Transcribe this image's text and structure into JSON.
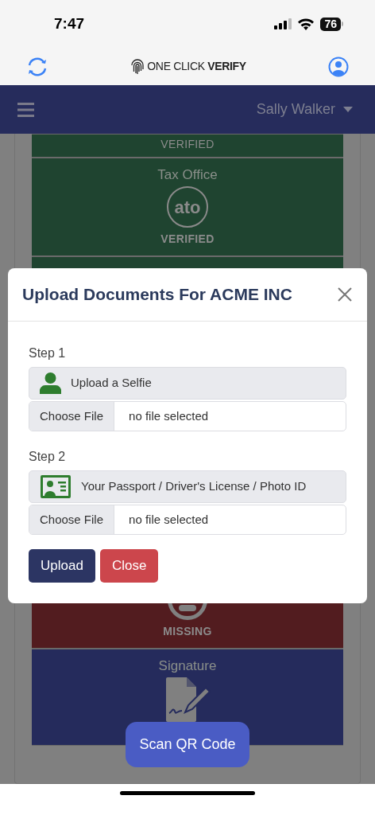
{
  "status_bar": {
    "time": "7:47",
    "battery": "76"
  },
  "app_header": {
    "logo_light": "ONE CLICK",
    "logo_bold": "VERIFY"
  },
  "navbar": {
    "user": "Sally Walker"
  },
  "cards": [
    {
      "kind": "verified",
      "status_label": "VERIFIED",
      "emphasis": false
    },
    {
      "title": "Tax Office",
      "logo": "ato",
      "kind": "verified",
      "status_label": "VERIFIED",
      "emphasis": true
    },
    {
      "kind": "verified"
    },
    {
      "kind": "missing",
      "status_label": "MISSING",
      "emphasis": true
    },
    {
      "title": "Signature",
      "kind": "pending"
    }
  ],
  "modal": {
    "title": "Upload Documents For ACME INC",
    "steps": [
      {
        "label": "Step 1",
        "kind": "selfie",
        "prompt": "Upload a Selfie",
        "file_button": "Choose File",
        "file_status": "no file selected"
      },
      {
        "label": "Step 2",
        "kind": "id",
        "prompt": "Your Passport / Driver's License / Photo ID",
        "file_button": "Choose File",
        "file_status": "no file selected"
      }
    ],
    "buttons": [
      {
        "label": "Upload",
        "kind": "primary"
      },
      {
        "label": "Close",
        "kind": "danger"
      }
    ]
  },
  "scan_button": "Scan QR Code"
}
